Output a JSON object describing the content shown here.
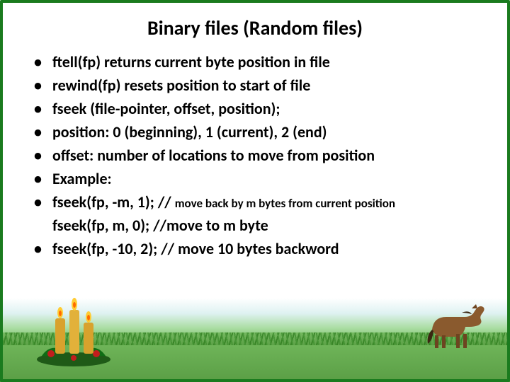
{
  "slide": {
    "title": "Binary files (Random files)",
    "bullets": [
      "ftell(fp) returns current byte position in file",
      " rewind(fp) resets position to start of file",
      "fseek (file-pointer, offset, position);",
      "position: 0 (beginning), 1 (current), 2 (end)",
      "offset: number of locations to move from position",
      "Example:"
    ],
    "bullet7_main": "fseek(fp, -m, 1); // ",
    "bullet7_sub": "move back by m bytes from current position",
    "cont_line": "fseek(fp, m, 0); //move to m byte",
    "bullet8": "fseek(fp, -10, 2); // move 10 bytes backword"
  },
  "decor": {
    "candles": "candles-with-holly",
    "horse": "horse-walking"
  }
}
